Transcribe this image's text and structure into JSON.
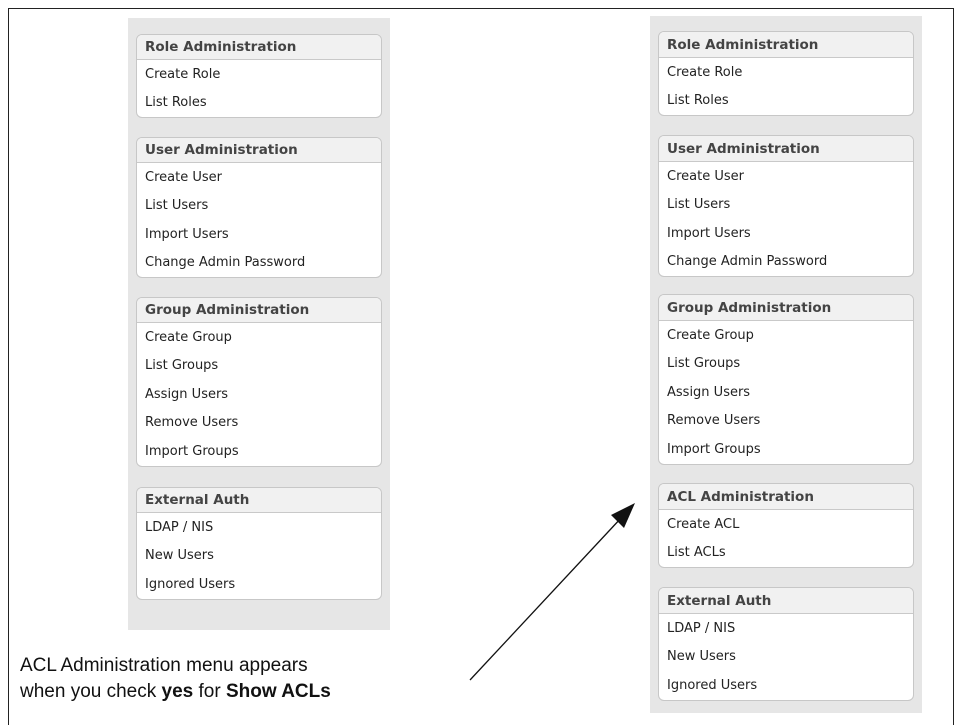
{
  "left_panel": {
    "menus": [
      {
        "title": "Role Administration",
        "items": [
          "Create Role",
          "List Roles"
        ]
      },
      {
        "title": "User Administration",
        "items": [
          "Create User",
          "List Users",
          "Import Users",
          "Change Admin Password"
        ]
      },
      {
        "title": "Group Administration",
        "items": [
          "Create Group",
          "List Groups",
          "Assign Users",
          "Remove Users",
          "Import Groups"
        ]
      },
      {
        "title": "External Auth",
        "items": [
          "LDAP / NIS",
          "New Users",
          "Ignored Users"
        ]
      }
    ]
  },
  "right_panel": {
    "menus": [
      {
        "title": "Role Administration",
        "items": [
          "Create Role",
          "List Roles"
        ]
      },
      {
        "title": "User Administration",
        "items": [
          "Create User",
          "List Users",
          "Import Users",
          "Change Admin Password"
        ]
      },
      {
        "title": "Group Administration",
        "items": [
          "Create Group",
          "List Groups",
          "Assign Users",
          "Remove Users",
          "Import Groups"
        ]
      },
      {
        "title": "ACL Administration",
        "items": [
          "Create ACL",
          "List ACLs"
        ]
      },
      {
        "title": "External Auth",
        "items": [
          "LDAP / NIS",
          "New Users",
          "Ignored Users"
        ]
      }
    ]
  },
  "callout": {
    "line1": "ACL Administration menu appears",
    "line2_prefix": "when you check ",
    "line2_yes": "yes",
    "line2_mid": " for ",
    "line2_show": "Show ACLs"
  },
  "colors": {
    "panel_bg": "#e6e6e6",
    "header_bg": "#f1f1f1",
    "border": "#c7c7c7"
  }
}
